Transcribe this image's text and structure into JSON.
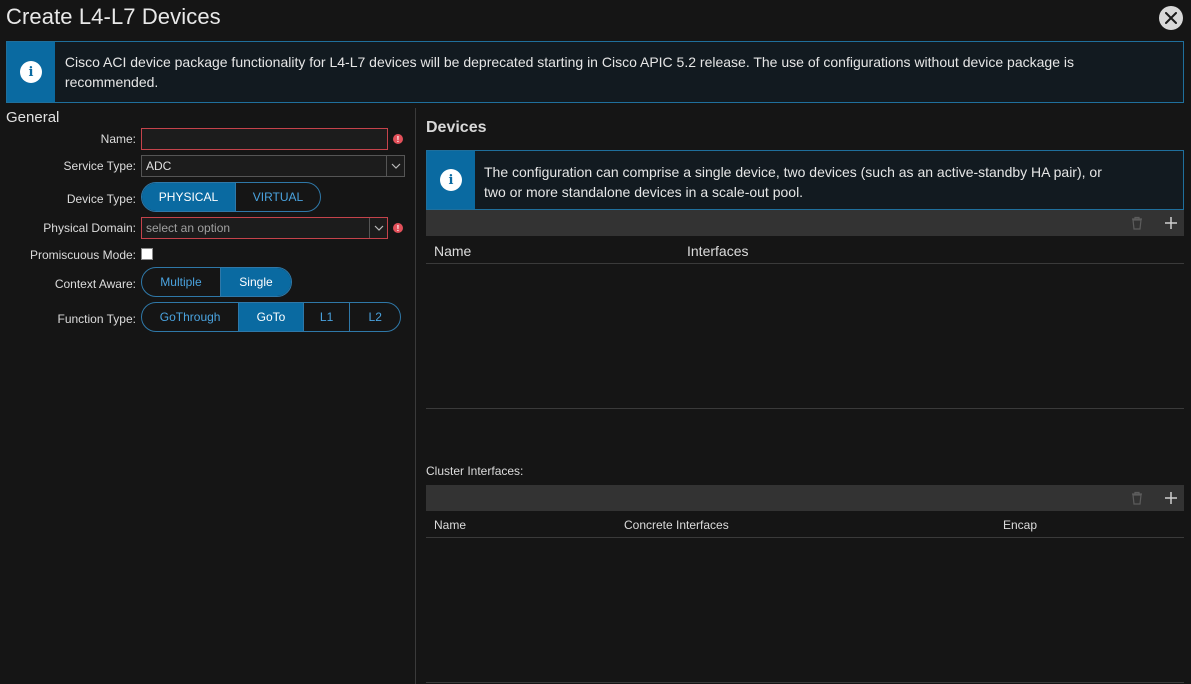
{
  "dialog": {
    "title": "Create L4-L7 Devices",
    "close_icon": "close-icon"
  },
  "banner": {
    "icon": "info-icon",
    "message": "Cisco ACI device package functionality for L4-L7 devices will be deprecated starting in Cisco APIC 5.2 release. The use of configurations without device package is recommended."
  },
  "general": {
    "title": "General",
    "name": {
      "label": "Name:",
      "value": ""
    },
    "service_type": {
      "label": "Service Type:",
      "value": "ADC"
    },
    "device_type": {
      "label": "Device Type:",
      "options": [
        "PHYSICAL",
        "VIRTUAL"
      ],
      "selected": "PHYSICAL"
    },
    "physical_domain": {
      "label": "Physical Domain:",
      "placeholder": "select an option"
    },
    "promiscuous_mode": {
      "label": "Promiscuous Mode:",
      "checked": false
    },
    "context_aware": {
      "label": "Context Aware:",
      "options": [
        "Multiple",
        "Single"
      ],
      "selected": "Single"
    },
    "function_type": {
      "label": "Function Type:",
      "options": [
        "GoThrough",
        "GoTo",
        "L1",
        "L2"
      ],
      "selected": "GoTo"
    }
  },
  "devices": {
    "title": "Devices",
    "info": "The configuration can comprise a single device, two devices (such as an active-standby HA pair), or two or more standalone devices in a scale-out pool.",
    "columns": [
      "Name",
      "Interfaces"
    ],
    "rows": []
  },
  "cluster": {
    "label": "Cluster Interfaces:",
    "columns": [
      "Name",
      "Concrete Interfaces",
      "Encap"
    ],
    "rows": []
  },
  "colors": {
    "accent": "#0a6aa1",
    "accent_text": "#4aa3df",
    "error": "#e2505a",
    "background": "#151515"
  }
}
